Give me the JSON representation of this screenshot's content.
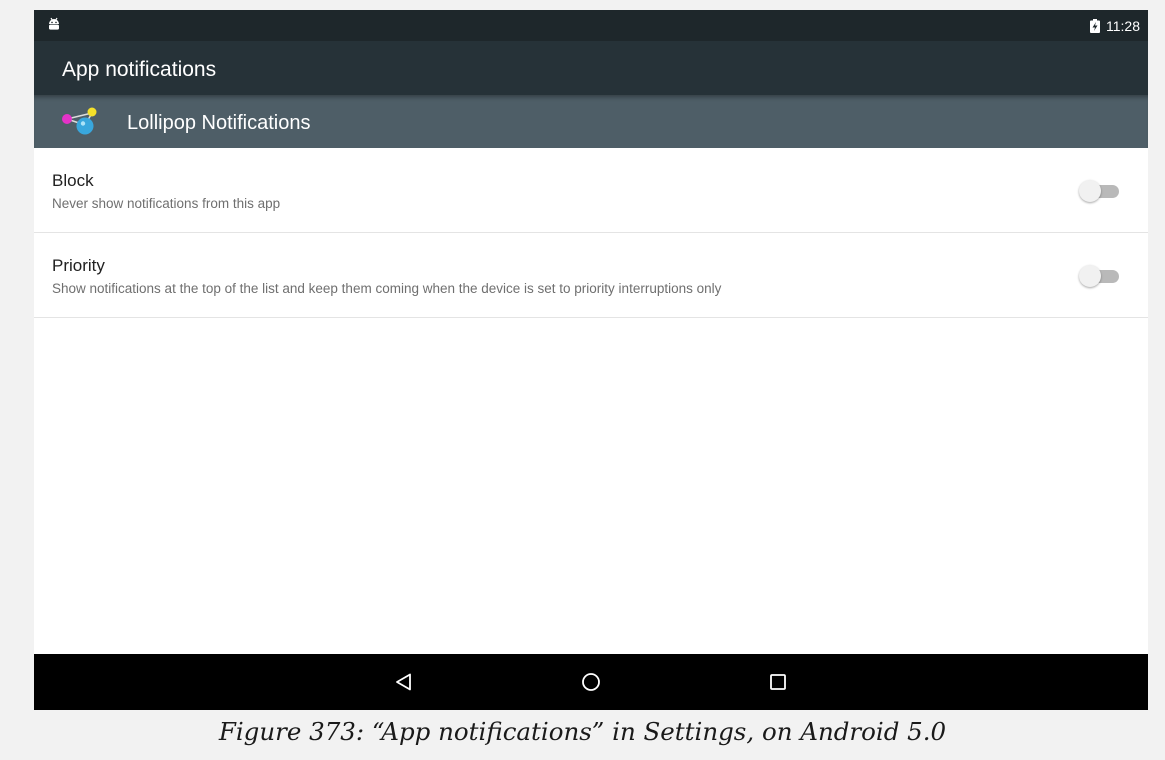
{
  "status_bar": {
    "notification_icon": "android-icon",
    "battery_icon": "battery-charging-icon",
    "time": "11:28"
  },
  "action_bar": {
    "title": "App notifications"
  },
  "app_header": {
    "icon": "lollipop-app-icon",
    "name": "Lollipop Notifications"
  },
  "preferences": [
    {
      "title": "Block",
      "summary": "Never show notifications from this app",
      "enabled": false
    },
    {
      "title": "Priority",
      "summary": "Show notifications at the top of the list and keep them coming when the device is set to priority interruptions only",
      "enabled": false
    }
  ],
  "nav_bar": {
    "back_icon": "back-triangle-icon",
    "home_icon": "home-circle-icon",
    "recents_icon": "recents-square-icon"
  },
  "caption": "Figure 373: “App notifications” in Settings, on Android 5.0",
  "colors": {
    "status_bar": "#1e272b",
    "action_bar": "#263238",
    "app_header": "#4e5e67",
    "nav_bar": "#000000"
  }
}
